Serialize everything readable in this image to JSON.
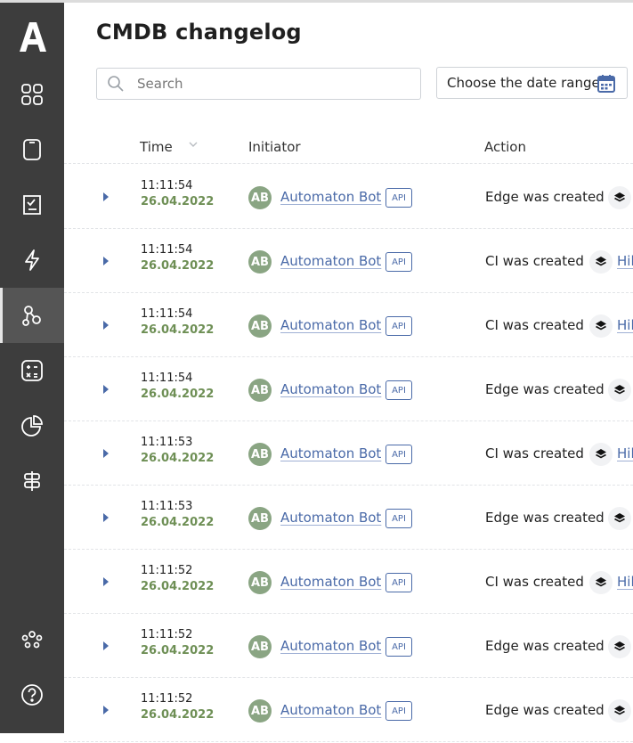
{
  "page": {
    "title": "CMDB changelog"
  },
  "search": {
    "placeholder": "Search"
  },
  "date_range": {
    "label": "Choose the date range"
  },
  "table": {
    "headers": {
      "time": "Time",
      "initiator": "Initiator",
      "action": "Action"
    },
    "rows": [
      {
        "time": "11:11:54",
        "date": "26.04.2022",
        "initiator": "Automaton Bot",
        "badge": "API",
        "action": "Edge was created",
        "link": ""
      },
      {
        "time": "11:11:54",
        "date": "26.04.2022",
        "initiator": "Automaton Bot",
        "badge": "API",
        "action": "CI was created",
        "link": "Hil"
      },
      {
        "time": "11:11:54",
        "date": "26.04.2022",
        "initiator": "Automaton Bot",
        "badge": "API",
        "action": "CI was created",
        "link": "Hil"
      },
      {
        "time": "11:11:54",
        "date": "26.04.2022",
        "initiator": "Automaton Bot",
        "badge": "API",
        "action": "Edge was created",
        "link": ""
      },
      {
        "time": "11:11:53",
        "date": "26.04.2022",
        "initiator": "Automaton Bot",
        "badge": "API",
        "action": "CI was created",
        "link": "Hil"
      },
      {
        "time": "11:11:53",
        "date": "26.04.2022",
        "initiator": "Automaton Bot",
        "badge": "API",
        "action": "Edge was created",
        "link": ""
      },
      {
        "time": "11:11:52",
        "date": "26.04.2022",
        "initiator": "Automaton Bot",
        "badge": "API",
        "action": "CI was created",
        "link": "Hil"
      },
      {
        "time": "11:11:52",
        "date": "26.04.2022",
        "initiator": "Automaton Bot",
        "badge": "API",
        "action": "Edge was created",
        "link": ""
      },
      {
        "time": "11:11:52",
        "date": "26.04.2022",
        "initiator": "Automaton Bot",
        "badge": "API",
        "action": "Edge was created",
        "link": ""
      }
    ]
  },
  "avatar_initials": "AB",
  "sidebar": {
    "logo": "A",
    "items": [
      {
        "icon": "grid-icon",
        "active": false
      },
      {
        "icon": "device-icon",
        "active": false
      },
      {
        "icon": "checklist-icon",
        "active": false
      },
      {
        "icon": "lightning-icon",
        "active": false
      },
      {
        "icon": "graph-nodes-icon",
        "active": true
      },
      {
        "icon": "calculator-icon",
        "active": false
      },
      {
        "icon": "pie-chart-icon",
        "active": false
      },
      {
        "icon": "signpost-icon",
        "active": false
      },
      {
        "icon": "team-icon",
        "active": false
      },
      {
        "icon": "help-icon",
        "active": false
      }
    ]
  },
  "colors": {
    "sidebar": "#3d3d3d",
    "link": "#4a6aa8",
    "date": "#6e8f55",
    "avatar": "#8aa583"
  }
}
